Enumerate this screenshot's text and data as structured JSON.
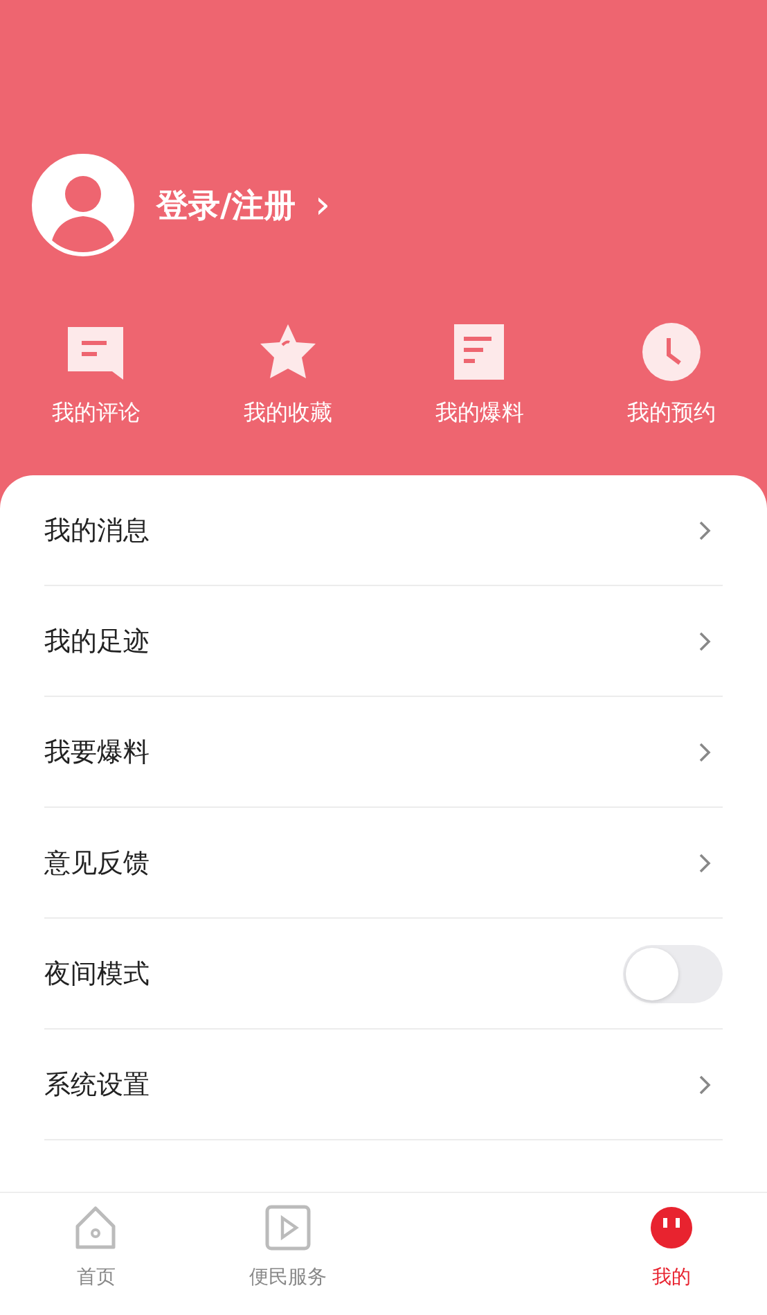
{
  "profile": {
    "login_label": "登录/注册",
    "chevron": "›"
  },
  "shortcuts": [
    {
      "kind": "comment",
      "label": "我的评论"
    },
    {
      "kind": "star",
      "label": "我的收藏"
    },
    {
      "kind": "doc",
      "label": "我的爆料"
    },
    {
      "kind": "clock",
      "label": "我的预约"
    }
  ],
  "menu": [
    {
      "kind": "link",
      "label": "我的消息"
    },
    {
      "kind": "link",
      "label": "我的足迹"
    },
    {
      "kind": "link",
      "label": "我要爆料"
    },
    {
      "kind": "link",
      "label": "意见反馈"
    },
    {
      "kind": "toggle",
      "label": "夜间模式",
      "on": false
    },
    {
      "kind": "link",
      "label": "系统设置"
    }
  ],
  "bottom_nav": [
    {
      "kind": "home",
      "label": "首页",
      "selected": false
    },
    {
      "kind": "play",
      "label": "便民服务",
      "selected": false
    },
    {
      "kind": "mine",
      "label": "我的",
      "selected": true
    }
  ]
}
